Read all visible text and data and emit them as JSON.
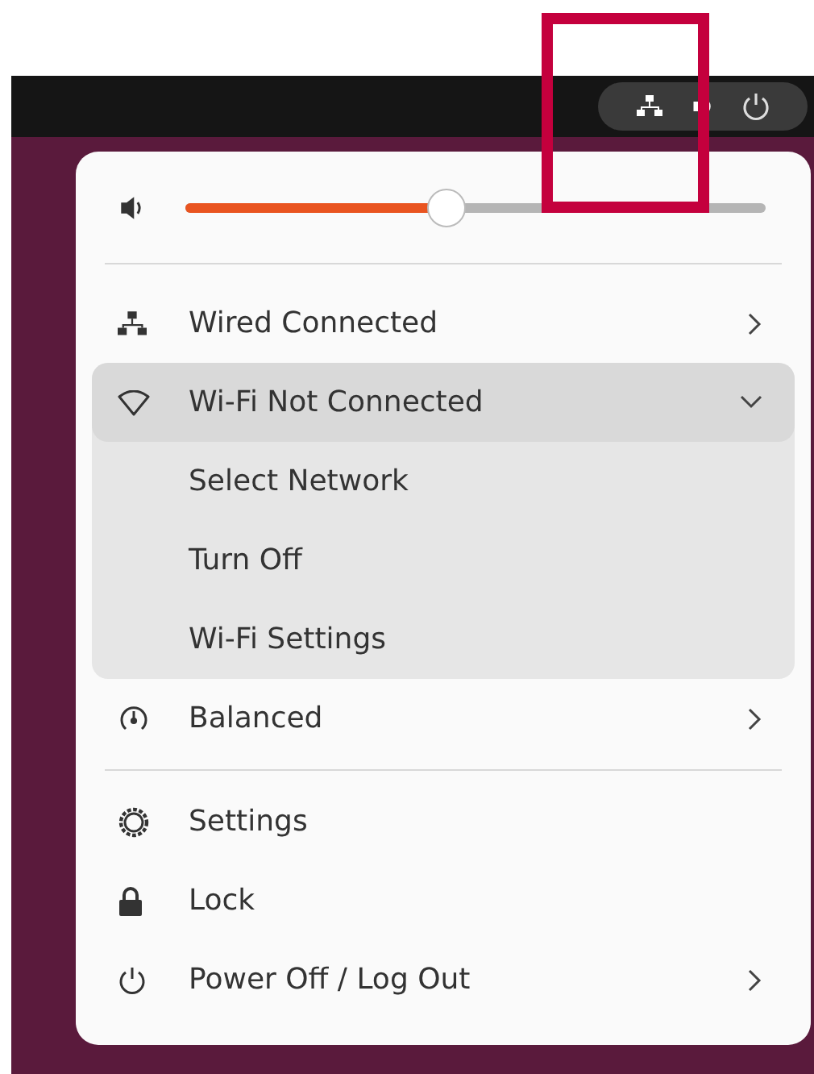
{
  "volume": {
    "level": 0.45
  },
  "sections": [
    {
      "items": [
        {
          "kind": "wired",
          "label": "Wired Connected",
          "expanded": false
        },
        {
          "kind": "wifi",
          "label": "Wi-Fi Not Connected",
          "expanded": true,
          "submenu": [
            "Select Network",
            "Turn Off",
            "Wi-Fi Settings"
          ]
        },
        {
          "kind": "power-mode",
          "label": "Balanced",
          "expanded": false
        }
      ]
    },
    {
      "items": [
        {
          "kind": "settings",
          "label": "Settings"
        },
        {
          "kind": "lock",
          "label": "Lock"
        },
        {
          "kind": "power",
          "label": "Power Off / Log Out",
          "expanded": false
        }
      ]
    }
  ]
}
